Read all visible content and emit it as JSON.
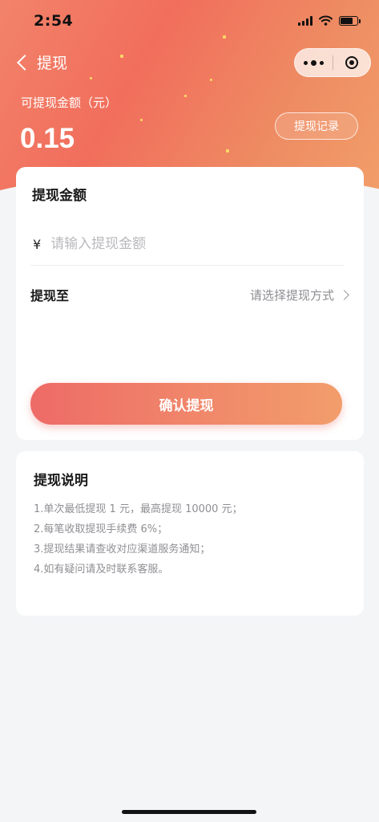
{
  "status_bar": {
    "time": "2:54",
    "icons": [
      "signal-icon",
      "wifi-icon",
      "battery-icon"
    ]
  },
  "nav": {
    "back_icon": "chevron-left-icon",
    "title": "提现",
    "capsule": {
      "more_icon": "more-dots-icon",
      "close_icon": "target-circle-icon"
    }
  },
  "balance": {
    "label": "可提现金额（元）",
    "value": "0.15",
    "records_button": "提现记录"
  },
  "withdraw_card": {
    "heading": "提现金额",
    "currency_symbol": "¥",
    "amount_placeholder": "请输入提现金额",
    "amount_value": "",
    "method_label": "提现至",
    "method_placeholder": "请选择提现方式",
    "method_icon": "chevron-right-icon",
    "confirm_button": "确认提现"
  },
  "notes_card": {
    "heading": "提现说明",
    "items": [
      "1.单次最低提现 1 元，最高提现 10000 元；",
      "2.每笔收取提现手续费 6%；",
      "3.提现结果请查收对应渠道服务通知；",
      "4.如有疑问请及时联系客服。"
    ]
  },
  "colors": {
    "header_gradient_start": "#f2836a",
    "header_gradient_end": "#f2a06a",
    "button_gradient_start": "#ee6b67",
    "button_gradient_end": "#f29d6b",
    "page_background": "#f4f5f7",
    "muted_text": "#8f8f94",
    "placeholder_text": "#b9b9bd"
  }
}
